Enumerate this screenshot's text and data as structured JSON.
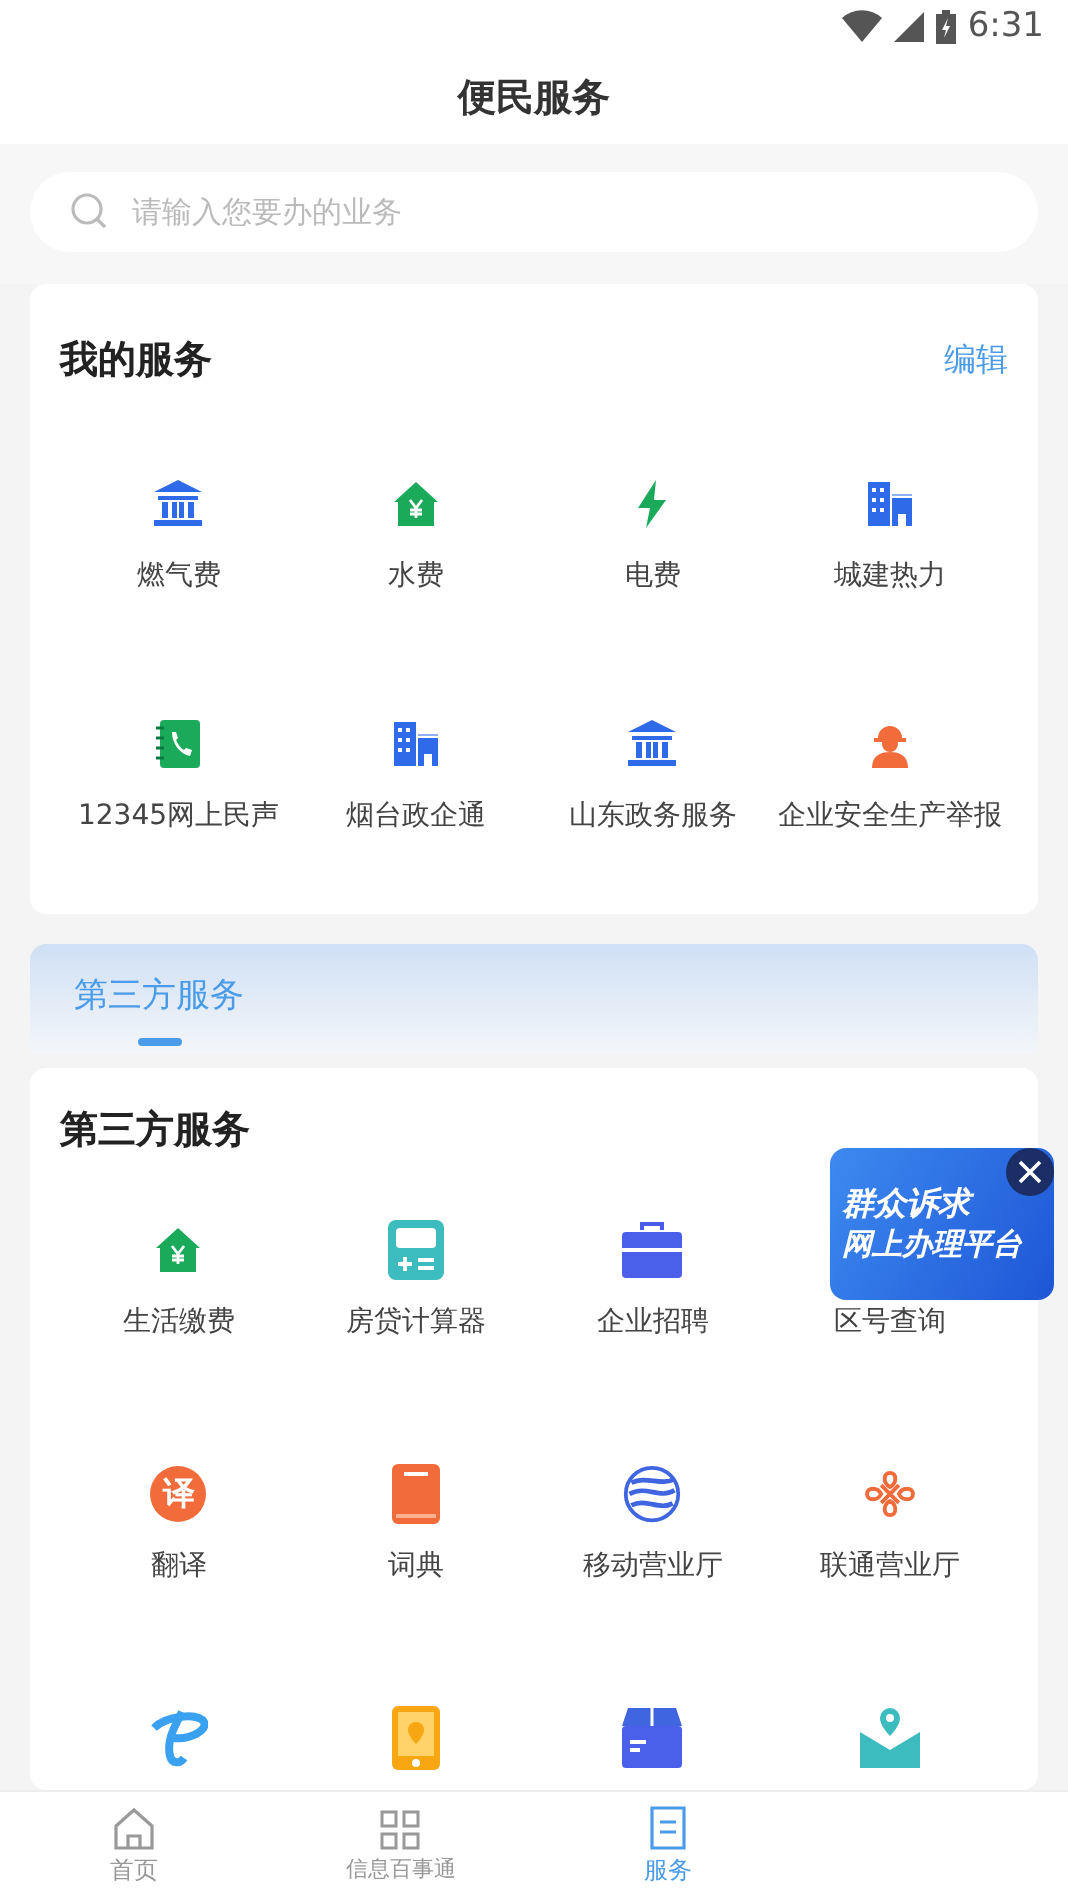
{
  "status_bar": {
    "time": "6:31"
  },
  "header": {
    "title": "便民服务"
  },
  "search": {
    "placeholder": "请输入您要办的业务"
  },
  "my_services": {
    "title": "我的服务",
    "action": "编辑",
    "items": [
      {
        "label": "燃气费",
        "kind": "bank"
      },
      {
        "label": "水费",
        "kind": "house-yen"
      },
      {
        "label": "电费",
        "kind": "bolt"
      },
      {
        "label": "城建热力",
        "kind": "building"
      },
      {
        "label": "12345网上民声",
        "kind": "phonebook"
      },
      {
        "label": "烟台政企通",
        "kind": "building"
      },
      {
        "label": "山东政务服务",
        "kind": "bank"
      },
      {
        "label": "企业安全生产举报",
        "kind": "worker"
      }
    ]
  },
  "section_tabs": [
    {
      "label": "第三方服务",
      "selected": true
    }
  ],
  "third_party": {
    "title": "第三方服务",
    "items": [
      {
        "label": "生活缴费",
        "kind": "house-yen"
      },
      {
        "label": "房贷计算器",
        "kind": "calculator"
      },
      {
        "label": "企业招聘",
        "kind": "briefcase"
      },
      {
        "label": "区号查询",
        "kind": "none"
      },
      {
        "label": "翻译",
        "kind": "translate",
        "glyph": "译"
      },
      {
        "label": "词典",
        "kind": "book"
      },
      {
        "label": "移动营业厅",
        "kind": "globe"
      },
      {
        "label": "联通营业厅",
        "kind": "knot"
      },
      {
        "kind": "telecom"
      },
      {
        "kind": "phone-pin"
      },
      {
        "kind": "box"
      },
      {
        "kind": "map-mail"
      }
    ]
  },
  "floating_banner": {
    "lines": [
      "群众诉求",
      "网上办理平台"
    ]
  },
  "bottom_nav": [
    {
      "label": "首页",
      "kind": "home",
      "selected": false
    },
    {
      "label": "信息百事通",
      "kind": "grid",
      "selected": false
    },
    {
      "label": "服务",
      "kind": "service",
      "selected": true
    }
  ]
}
